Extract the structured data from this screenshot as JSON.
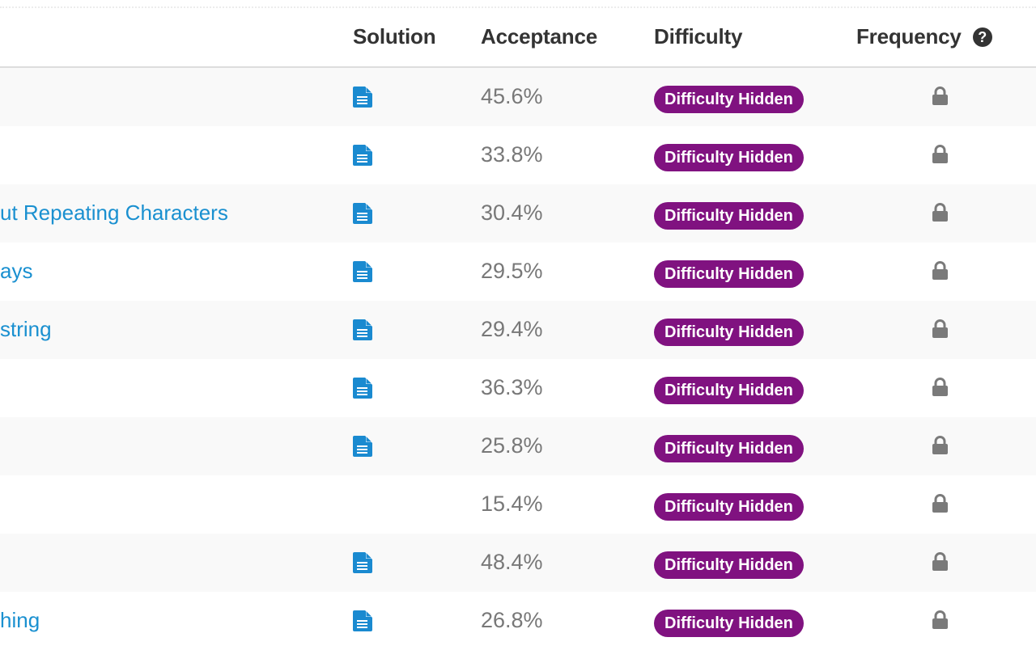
{
  "table": {
    "columns": {
      "solution": "Solution",
      "acceptance": "Acceptance",
      "difficulty": "Difficulty",
      "frequency": "Frequency",
      "frequency_help_icon": "?"
    },
    "colors": {
      "link": "#1a90d0",
      "badge_bg": "#801280",
      "solution_icon": "#1a8ad0",
      "lock_icon": "#7a7a7a"
    },
    "rows": [
      {
        "title": "",
        "has_solution": true,
        "acceptance": "45.6%",
        "difficulty": "Difficulty Hidden",
        "frequency": "locked"
      },
      {
        "title": "",
        "has_solution": true,
        "acceptance": "33.8%",
        "difficulty": "Difficulty Hidden",
        "frequency": "locked"
      },
      {
        "title": "ut Repeating Characters",
        "has_solution": true,
        "acceptance": "30.4%",
        "difficulty": "Difficulty Hidden",
        "frequency": "locked"
      },
      {
        "title": "ays",
        "has_solution": true,
        "acceptance": "29.5%",
        "difficulty": "Difficulty Hidden",
        "frequency": "locked"
      },
      {
        "title": "string",
        "has_solution": true,
        "acceptance": "29.4%",
        "difficulty": "Difficulty Hidden",
        "frequency": "locked"
      },
      {
        "title": "",
        "has_solution": true,
        "acceptance": "36.3%",
        "difficulty": "Difficulty Hidden",
        "frequency": "locked"
      },
      {
        "title": "",
        "has_solution": true,
        "acceptance": "25.8%",
        "difficulty": "Difficulty Hidden",
        "frequency": "locked"
      },
      {
        "title": "",
        "has_solution": false,
        "acceptance": "15.4%",
        "difficulty": "Difficulty Hidden",
        "frequency": "locked"
      },
      {
        "title": "",
        "has_solution": true,
        "acceptance": "48.4%",
        "difficulty": "Difficulty Hidden",
        "frequency": "locked"
      },
      {
        "title": "hing",
        "has_solution": true,
        "acceptance": "26.8%",
        "difficulty": "Difficulty Hidden",
        "frequency": "locked"
      }
    ]
  }
}
